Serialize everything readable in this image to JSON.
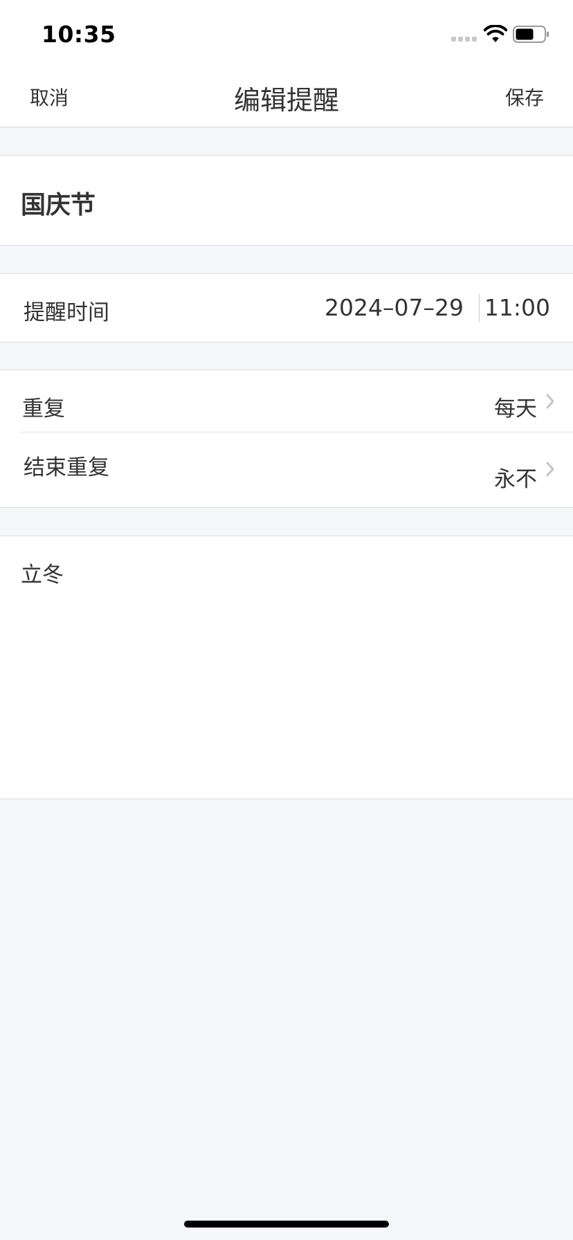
{
  "status_bar": {
    "time": "10:35",
    "icons": [
      "signal-dots-icon",
      "wifi-icon",
      "battery-icon"
    ]
  },
  "nav": {
    "cancel_label": "取消",
    "title": "编辑提醒",
    "save_label": "保存"
  },
  "reminder": {
    "title": "国庆节",
    "time_label": "提醒时间",
    "date": "2024–07–29",
    "time": "11:00",
    "repeat_label": "重复",
    "repeat_value": "每天",
    "end_repeat_label": "结束重复",
    "end_repeat_value": "永不",
    "note": "立冬"
  },
  "colors": {
    "background": "#f4f6f8",
    "surface": "#ffffff",
    "text": "#333333",
    "divider": "#dcdde0",
    "chevron": "#c4c4c6"
  }
}
